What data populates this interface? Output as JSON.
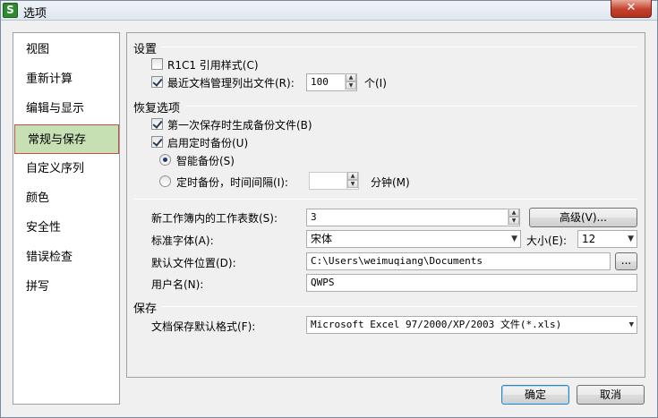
{
  "window": {
    "title": "选项",
    "app_icon_glyph": "S",
    "close_glyph": "✕"
  },
  "nav": {
    "items": [
      {
        "label": "视图"
      },
      {
        "label": "重新计算"
      },
      {
        "label": "编辑与显示"
      },
      {
        "label": "常规与保存"
      },
      {
        "label": "自定义序列"
      },
      {
        "label": "颜色"
      },
      {
        "label": "安全性"
      },
      {
        "label": "错误检查"
      },
      {
        "label": "拼写"
      }
    ],
    "selected_index": 3
  },
  "settings": {
    "header": "设置",
    "r1c1_label": "R1C1 引用样式(C)",
    "r1c1_checked": false,
    "recent_label": "最近文档管理列出文件(R):",
    "recent_checked": true,
    "recent_value": "100",
    "recent_unit": "个(I)"
  },
  "recovery": {
    "header": "恢复选项",
    "first_save_backup_label": "第一次保存时生成备份文件(B)",
    "first_save_backup_checked": true,
    "timed_backup_label": "启用定时备份(U)",
    "timed_backup_checked": true,
    "smart_backup_label": "智能备份(S)",
    "smart_backup_selected": true,
    "interval_backup_label": "定时备份，时间间隔(I):",
    "interval_backup_selected": false,
    "interval_value": "",
    "interval_unit": "分钟(M)"
  },
  "general": {
    "sheets_label": "新工作簿内的工作表数(S):",
    "sheets_value": "3",
    "advanced_button": "高级(V)...",
    "font_label": "标准字体(A):",
    "font_value": "宋体",
    "size_label": "大小(E):",
    "size_value": "12",
    "path_label": "默认文件位置(D):",
    "path_value": "C:\\Users\\weimuqiang\\Documents",
    "browse_button": "...",
    "username_label": "用户名(N):",
    "username_value": "QWPS"
  },
  "save": {
    "header": "保存",
    "format_label": "文档保存默认格式(F):",
    "format_value": "Microsoft Excel 97/2000/XP/2003 文件(*.xls)"
  },
  "footer": {
    "ok_button": "确定",
    "cancel_button": "取消"
  }
}
